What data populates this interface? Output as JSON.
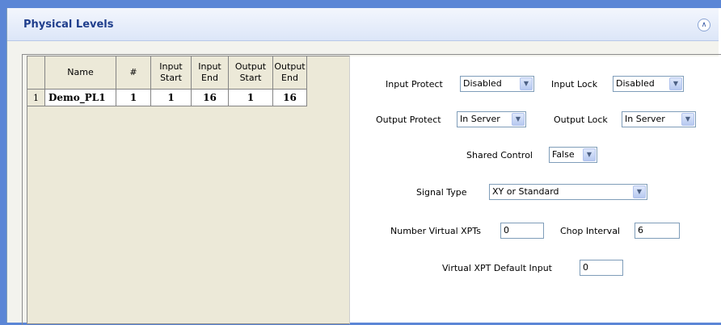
{
  "panel": {
    "title": "Physical Levels"
  },
  "grid": {
    "headers": [
      "Name",
      "#",
      "Input\nStart",
      "Input\nEnd",
      "Output\nStart",
      "Output\nEnd"
    ],
    "rows": [
      {
        "row_number": "1",
        "name": "Demo_PL1",
        "num": "1",
        "input_start": "1",
        "input_end": "16",
        "output_start": "1",
        "output_end": "16"
      }
    ]
  },
  "form": {
    "input_protect": {
      "label": "Input Protect",
      "value": "Disabled"
    },
    "input_lock": {
      "label": "Input Lock",
      "value": "Disabled"
    },
    "output_protect": {
      "label": "Output Protect",
      "value": "In Server"
    },
    "output_lock": {
      "label": "Output Lock",
      "value": "In Server"
    },
    "shared_control": {
      "label": "Shared Control",
      "value": "False"
    },
    "signal_type": {
      "label": "Signal Type",
      "value": "XY or Standard"
    },
    "number_virtual_xpts": {
      "label": "Number Virtual XPTs",
      "value": "0"
    },
    "chop_interval": {
      "label": "Chop Interval",
      "value": "6"
    },
    "virtual_xpt_default_input": {
      "label": "Virtual XPT Default Input",
      "value": "0"
    }
  },
  "icons": {
    "collapse": "double-chevron-up-icon",
    "dropdown": "chevron-down-icon"
  }
}
